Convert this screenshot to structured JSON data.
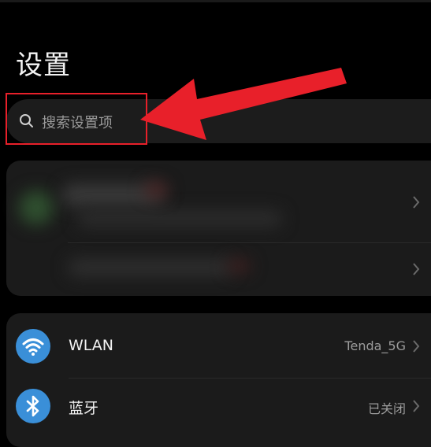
{
  "page": {
    "title": "设置"
  },
  "search": {
    "placeholder": "搜索设置项",
    "icon": "search-icon"
  },
  "annotation": {
    "color": "#e8202a"
  },
  "settings": {
    "items": [
      {
        "label": "WLAN",
        "value": "Tenda_5G",
        "icon": "wifi-icon",
        "icon_color": "#3a8fd8"
      },
      {
        "label": "蓝牙",
        "value": "已关闭",
        "icon": "bluetooth-icon",
        "icon_color": "#3a8fd8"
      }
    ]
  },
  "colors": {
    "background": "#000000",
    "card": "#1b1b1b",
    "accent": "#3a8fd8"
  }
}
